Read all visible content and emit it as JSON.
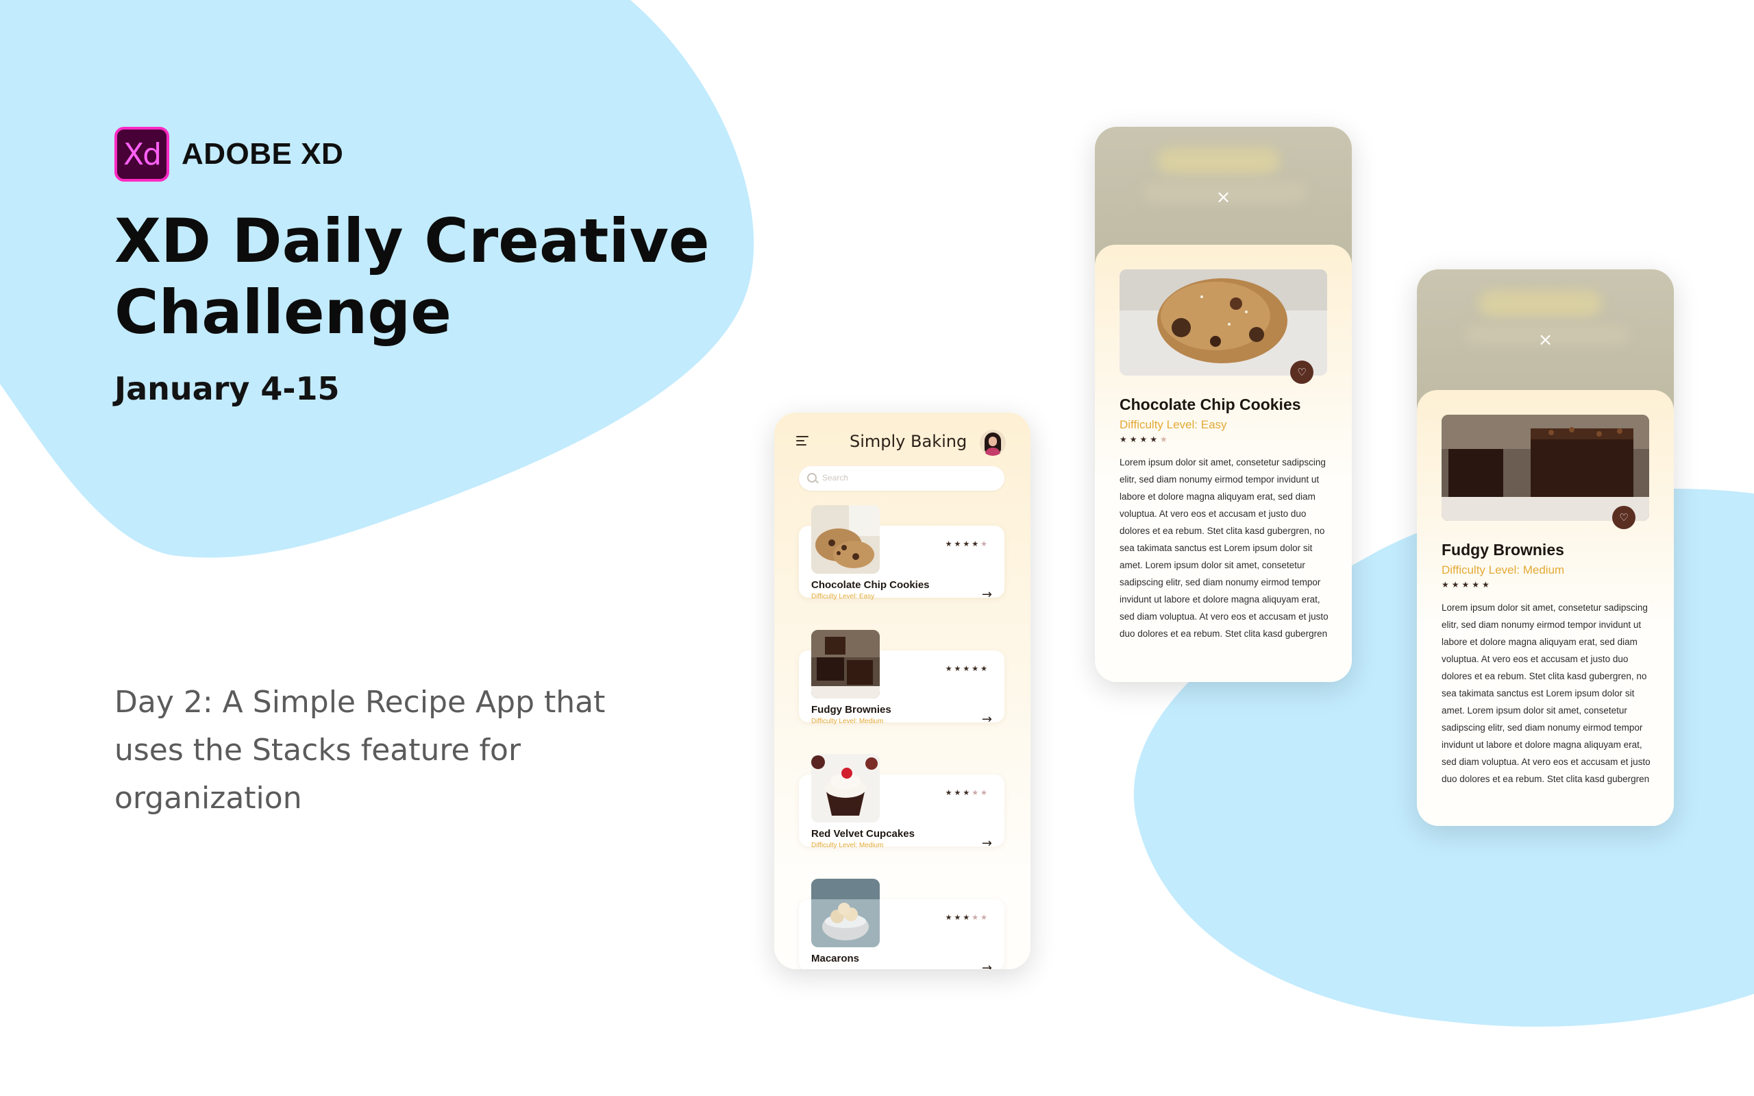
{
  "hero": {
    "brand": "ADOBE XD",
    "logo_text": "Xd",
    "title": "XD Daily Creative Challenge",
    "dates": "January 4-15",
    "subtitle": "Day 2: A Simple Recipe App that uses the Stacks feature for organization"
  },
  "colors": {
    "blob": "#c2ebfd",
    "accent_gold": "#e3a935",
    "heart_bg": "#5b2e22",
    "xd_bg": "#470137",
    "xd_border": "#ff2bc2"
  },
  "list_screen": {
    "app_title": "Simply Baking",
    "search_placeholder": "Search",
    "recipes": [
      {
        "name": "Chocolate Chip Cookies",
        "level": "Difficulty Level: Easy",
        "rating": 4,
        "stars_on": "★★★★",
        "stars_off": "★"
      },
      {
        "name": "Fudgy Brownies",
        "level": "Difficulty Level: Medium",
        "rating": 5,
        "stars_on": "★★★★★",
        "stars_off": ""
      },
      {
        "name": "Red Velvet Cupcakes",
        "level": "Difficulty Level: Medium",
        "rating": 3,
        "stars_on": "★★★",
        "stars_off": "★★"
      },
      {
        "name": "Macarons",
        "level": "",
        "rating": 3,
        "stars_on": "★★★",
        "stars_off": "★★"
      }
    ]
  },
  "detail_1": {
    "name": "Chocolate Chip Cookies",
    "level": "Difficulty Level: Easy",
    "rating": 4,
    "stars_on": "★★★★",
    "stars_off": "★",
    "body": "Lorem ipsum dolor sit amet, consetetur sadipscing elitr, sed diam nonumy eirmod tempor invidunt ut labore et dolore magna aliquyam erat, sed diam voluptua. At vero eos et accusam et justo duo dolores et ea rebum. Stet clita kasd gubergren, no sea takimata sanctus est Lorem ipsum dolor sit amet. Lorem ipsum dolor sit amet, consetetur sadipscing elitr, sed diam nonumy eirmod tempor invidunt ut labore et dolore magna aliquyam erat, sed diam voluptua. At vero eos et accusam et justo duo dolores et ea rebum. Stet clita kasd gubergren"
  },
  "detail_2": {
    "name": "Fudgy Brownies",
    "level": "Difficulty Level: Medium",
    "rating": 5,
    "stars_on": "★★★★★",
    "stars_off": "",
    "body": "Lorem ipsum dolor sit amet, consetetur sadipscing elitr, sed diam nonumy eirmod tempor invidunt ut labore et dolore magna aliquyam erat, sed diam voluptua. At vero eos et accusam et justo duo dolores et ea rebum. Stet clita kasd gubergren, no sea takimata sanctus est Lorem ipsum dolor sit amet. Lorem ipsum dolor sit amet, consetetur sadipscing elitr, sed diam nonumy eirmod tempor invidunt ut labore et dolore magna aliquyam erat, sed diam voluptua. At vero eos et accusam et justo duo dolores et ea rebum. Stet clita kasd gubergren"
  },
  "icons": {
    "close": "×",
    "heart": "♡",
    "arrow": "→",
    "menu": "menu-icon",
    "search": "search-icon"
  }
}
